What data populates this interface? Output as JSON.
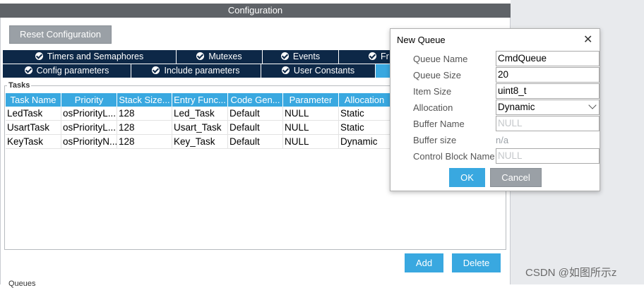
{
  "window": {
    "title": "Configuration"
  },
  "reset_button": "Reset Configuration",
  "tabs_row1": [
    "Timers and Semaphores",
    "Mutexes",
    "Events",
    "Fr"
  ],
  "tabs_row2": [
    "Config parameters",
    "Include parameters",
    "User Constants",
    ""
  ],
  "tasks_group": {
    "label": "Tasks",
    "columns": [
      "Task Name",
      "Priority",
      "Stack Size...",
      "Entry Func...",
      "Code Gen...",
      "Parameter",
      "Allocation"
    ],
    "rows": [
      [
        "LedTask",
        "osPriorityL...",
        "128",
        "Led_Task",
        "Default",
        "NULL",
        "Static"
      ],
      [
        "UsartTask",
        "osPriorityL...",
        "128",
        "Usart_Task",
        "Default",
        "NULL",
        "Static"
      ],
      [
        "KeyTask",
        "osPriorityN...",
        "128",
        "Key_Task",
        "Default",
        "NULL",
        "Dynamic"
      ]
    ]
  },
  "add_button": "Add",
  "delete_button": "Delete",
  "queues_label": "Queues",
  "dialog": {
    "title": "New Queue",
    "queue_name_label": "Queue Name",
    "queue_name_value": "CmdQueue",
    "queue_size_label": "Queue Size",
    "queue_size_value": "20",
    "item_size_label": "Item Size",
    "item_size_value": "uint8_t",
    "allocation_label": "Allocation",
    "allocation_value": "Dynamic",
    "buffer_name_label": "Buffer Name",
    "buffer_name_placeholder": "NULL",
    "buffer_size_label": "Buffer size",
    "buffer_size_value": "n/a",
    "control_block_label": "Control Block Name",
    "control_block_placeholder": "NULL",
    "ok_button": "OK",
    "cancel_button": "Cancel"
  },
  "watermark": "CSDN @如图所示z"
}
